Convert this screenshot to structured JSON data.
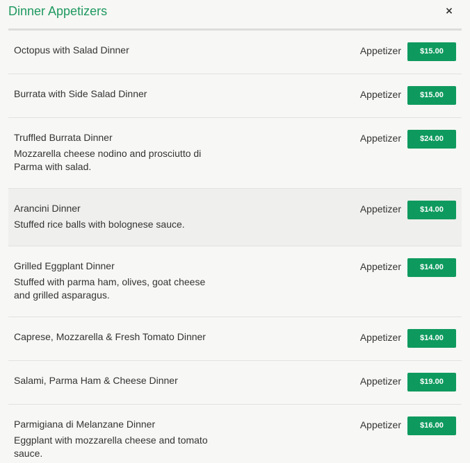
{
  "modal": {
    "title": "Dinner Appetizers",
    "close_label": "×"
  },
  "colors": {
    "title": "#1f9960",
    "price_button": "#0e9a5e",
    "highlight_row": "#efefed"
  },
  "items": [
    {
      "name": "Octopus with Salad Dinner",
      "description": "",
      "category": "Appetizer",
      "price": "$15.00"
    },
    {
      "name": "Burrata with Side Salad Dinner",
      "description": "",
      "category": "Appetizer",
      "price": "$15.00"
    },
    {
      "name": "Truffled Burrata Dinner",
      "description": "Mozzarella cheese nodino and prosciutto di Parma with salad.",
      "category": "Appetizer",
      "price": "$24.00"
    },
    {
      "name": "Arancini Dinner",
      "description": "Stuffed rice balls with bolognese sauce.",
      "category": "Appetizer",
      "price": "$14.00",
      "highlighted": true
    },
    {
      "name": "Grilled Eggplant Dinner",
      "description": "Stuffed with parma ham, olives, goat cheese and grilled asparagus.",
      "category": "Appetizer",
      "price": "$14.00"
    },
    {
      "name": "Caprese, Mozzarella & Fresh Tomato Dinner",
      "description": "",
      "category": "Appetizer",
      "price": "$14.00"
    },
    {
      "name": "Salami, Parma Ham & Cheese Dinner",
      "description": "",
      "category": "Appetizer",
      "price": "$19.00"
    },
    {
      "name": "Parmigiana di Melanzane Dinner",
      "description": "Eggplant with mozzarella cheese and tomato sauce.",
      "category": "Appetizer",
      "price": "$16.00"
    }
  ]
}
